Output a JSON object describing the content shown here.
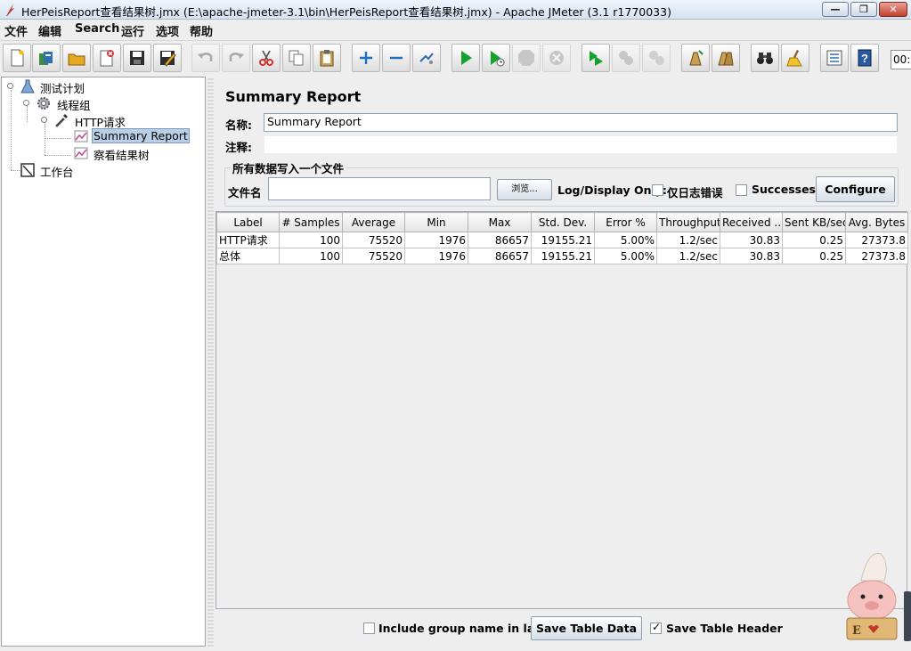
{
  "window": {
    "title": "HerPeisReport查看结果树.jmx (E:\\apache-jmeter-3.1\\bin\\HerPeisReport查看结果树.jmx) - Apache JMeter (3.1 r1770033)",
    "minimize": "—",
    "maximize": "❐",
    "close": "✕"
  },
  "menu": [
    "文件",
    "编辑",
    "Search",
    "运行",
    "选项",
    "帮助"
  ],
  "toolbar": {
    "buttons": [
      {
        "icon": "new-icon",
        "enabled": true
      },
      {
        "icon": "templates-icon",
        "enabled": true
      },
      {
        "icon": "open-icon",
        "enabled": true
      },
      {
        "icon": "close-file-icon",
        "enabled": true
      },
      {
        "icon": "save-icon",
        "enabled": true
      },
      {
        "icon": "save-as-icon",
        "enabled": true
      },
      {
        "icon": "undo-icon",
        "enabled": false
      },
      {
        "icon": "redo-icon",
        "enabled": false
      },
      {
        "icon": "cut-icon",
        "enabled": true
      },
      {
        "icon": "copy-icon",
        "enabled": true
      },
      {
        "icon": "paste-icon",
        "enabled": true
      },
      {
        "icon": "expand-icon",
        "enabled": true
      },
      {
        "icon": "collapse-icon",
        "enabled": true
      },
      {
        "icon": "toggle-icon",
        "enabled": true
      },
      {
        "icon": "start-icon",
        "enabled": true
      },
      {
        "icon": "start-no-timers-icon",
        "enabled": true
      },
      {
        "icon": "stop-icon",
        "enabled": false
      },
      {
        "icon": "shutdown-icon",
        "enabled": false
      },
      {
        "icon": "remote-start-icon",
        "enabled": true
      },
      {
        "icon": "remote-stop-icon",
        "enabled": false
      },
      {
        "icon": "remote-shutdown-icon",
        "enabled": false
      },
      {
        "icon": "clear-icon",
        "enabled": true
      },
      {
        "icon": "clear-all-icon",
        "enabled": true
      },
      {
        "icon": "search-icon",
        "enabled": true
      },
      {
        "icon": "reset-search-icon",
        "enabled": true
      },
      {
        "icon": "function-helper-icon",
        "enabled": true
      },
      {
        "icon": "help-icon",
        "enabled": true
      }
    ],
    "elapsed": "00:"
  },
  "tree": {
    "nodes": [
      {
        "label": "测试计划",
        "icon": "test-plan-icon"
      },
      {
        "label": "线程组",
        "icon": "thread-group-icon"
      },
      {
        "label": "HTTP请求",
        "icon": "http-sampler-icon"
      },
      {
        "label": "Summary Report",
        "icon": "listener-icon",
        "selected": true
      },
      {
        "label": "察看结果树",
        "icon": "listener-icon"
      },
      {
        "label": "工作台",
        "icon": "workbench-icon"
      }
    ]
  },
  "panel": {
    "title": "Summary Report",
    "name_label": "名称:",
    "name_value": "Summary Report",
    "comment_label": "注释:",
    "comment_value": "",
    "file_group_title": "所有数据写入一个文件",
    "filename_label": "文件名",
    "filename_value": "",
    "browse": "浏览...",
    "log_display_only": "Log/Display Only:",
    "errors_only": "仅日志错误",
    "successes": "Successes",
    "configure": "Configure"
  },
  "table": {
    "columns": [
      "Label",
      "# Samples",
      "Average",
      "Min",
      "Max",
      "Std. Dev.",
      "Error %",
      "Throughput",
      "Received ...",
      "Sent KB/sec",
      "Avg. Bytes"
    ],
    "rows": [
      [
        "HTTP请求",
        "100",
        "75520",
        "1976",
        "86657",
        "19155.21",
        "5.00%",
        "1.2/sec",
        "30.83",
        "0.25",
        "27373.8"
      ],
      [
        "总体",
        "100",
        "75520",
        "1976",
        "86657",
        "19155.21",
        "5.00%",
        "1.2/sec",
        "30.83",
        "0.25",
        "27373.8"
      ]
    ]
  },
  "footer": {
    "include_group_name": "Include group name in label?",
    "include_group_checked": false,
    "save_table_data": "Save Table Data",
    "save_table_header": "Save Table Header",
    "save_header_checked": true
  }
}
